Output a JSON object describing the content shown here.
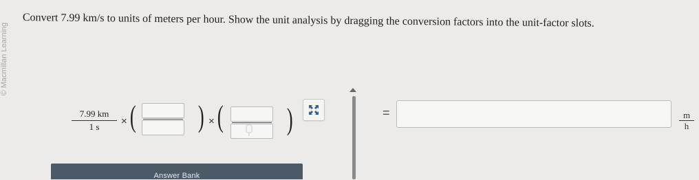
{
  "copyright": "© Macmillan Learning",
  "question": {
    "text": "Convert 7.99 km/s to units of meters per hour. Show the unit analysis by dragging the conversion factors into the unit-factor slots."
  },
  "equation": {
    "given_numerator": "7.99 km",
    "given_denominator": "1 s",
    "times_symbol": "×",
    "open_paren": "(",
    "close_paren": ")",
    "equals_symbol": "=",
    "answer_value": "",
    "unit_numerator": "m",
    "unit_denominator": "h"
  },
  "answer_bank": {
    "label": "Answer Bank"
  },
  "icons": {
    "expand": "expand-arrows-icon",
    "scroll_up": "scroll-up-arrow-icon"
  }
}
